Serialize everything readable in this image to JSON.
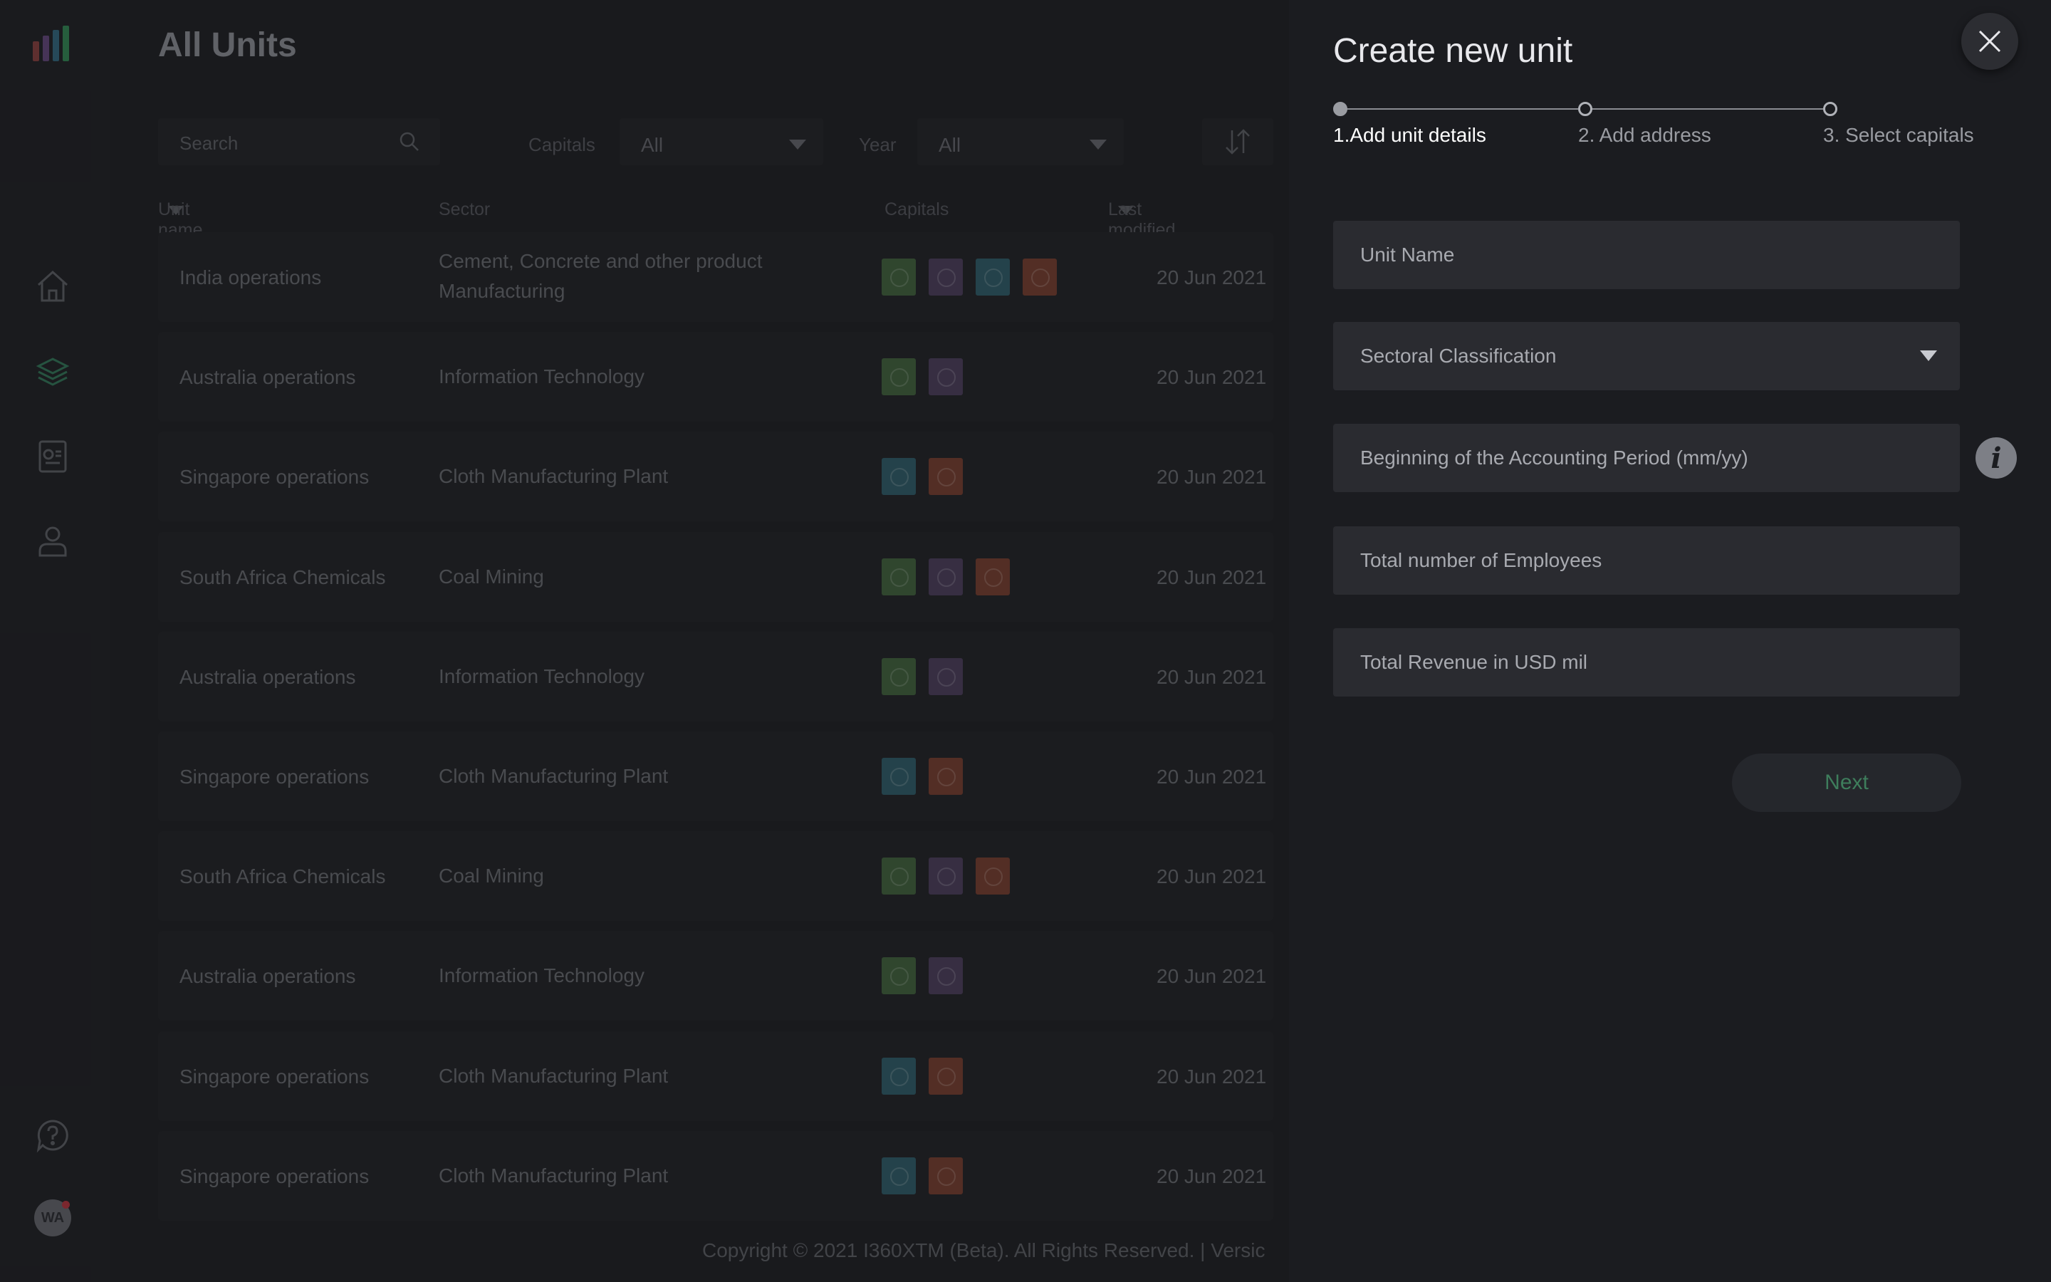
{
  "main": {
    "title": "All Units",
    "search": {
      "placeholder": "Search"
    },
    "filters": [
      {
        "label": "Capitals",
        "value": "All"
      },
      {
        "label": "Year",
        "value": "All"
      }
    ],
    "columns": {
      "unit_name": "Unit name",
      "sector": "Sector",
      "capitals": "Capitals",
      "last_modified": "Last modified"
    },
    "rows": [
      {
        "name": "India operations",
        "sector": "Cement, Concrete and other product Manufacturing",
        "capitals": [
          "g",
          "p",
          "t",
          "o"
        ],
        "date": "20 Jun 2021"
      },
      {
        "name": "Australia operations",
        "sector": "Information Technology",
        "capitals": [
          "g",
          "p"
        ],
        "date": "20 Jun 2021"
      },
      {
        "name": "Singapore operations",
        "sector": "Cloth Manufacturing Plant",
        "capitals": [
          "t",
          "o"
        ],
        "date": "20 Jun 2021"
      },
      {
        "name": "South Africa Chemicals",
        "sector": "Coal Mining",
        "capitals": [
          "g",
          "p",
          "o"
        ],
        "date": "20 Jun 2021"
      },
      {
        "name": "Australia operations",
        "sector": "Information Technology",
        "capitals": [
          "g",
          "p"
        ],
        "date": "20 Jun 2021"
      },
      {
        "name": "Singapore operations",
        "sector": "Cloth Manufacturing Plant",
        "capitals": [
          "t",
          "o"
        ],
        "date": "20 Jun 2021"
      },
      {
        "name": "South Africa Chemicals",
        "sector": "Coal Mining",
        "capitals": [
          "g",
          "p",
          "o"
        ],
        "date": "20 Jun 2021"
      },
      {
        "name": "Australia operations",
        "sector": "Information Technology",
        "capitals": [
          "g",
          "p"
        ],
        "date": "20 Jun 2021"
      },
      {
        "name": "Singapore operations",
        "sector": "Cloth Manufacturing Plant",
        "capitals": [
          "t",
          "o"
        ],
        "date": "20 Jun 2021"
      },
      {
        "name": "Singapore operations",
        "sector": "Cloth Manufacturing Plant",
        "capitals": [
          "t",
          "o"
        ],
        "date": "20 Jun 2021"
      }
    ],
    "footer": "Copyright © 2021 I360XTM (Beta). All Rights Reserved. | Versic"
  },
  "sidebar": {
    "avatar_initials": "WA",
    "icons": [
      "home-icon",
      "layers-icon",
      "report-icon",
      "user-icon",
      "help-icon"
    ]
  },
  "panel": {
    "title": "Create new unit",
    "steps": [
      {
        "label": "1.Add unit details",
        "active": true
      },
      {
        "label": "2. Add address",
        "active": false
      },
      {
        "label": "3. Select capitals",
        "active": false
      }
    ],
    "fields": {
      "unit_name": "Unit Name",
      "sector": "Sectoral Classification",
      "accounting_period": "Beginning of the Accounting Period (mm/yy)",
      "employees": "Total number of Employees",
      "revenue": "Total Revenue in USD mil"
    },
    "next_label": "Next"
  },
  "colors": {
    "capital_green": "#3d5a3a",
    "capital_purple": "#463a55",
    "capital_teal": "#2d5560",
    "capital_orange": "#6b3a2e",
    "accent_green": "#3e7d5c"
  }
}
